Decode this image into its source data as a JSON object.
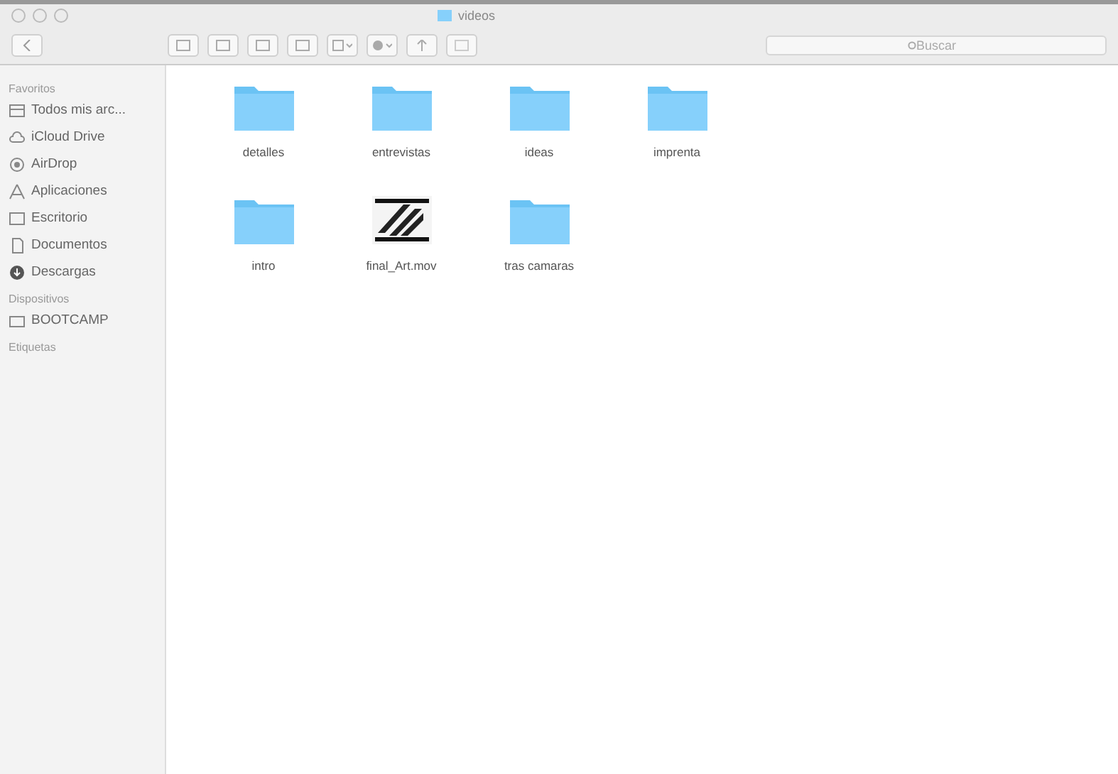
{
  "window": {
    "title": "videos"
  },
  "search": {
    "placeholder": "Buscar"
  },
  "sidebar": {
    "sections": [
      {
        "heading": "Favoritos",
        "items": [
          {
            "label": "Todos mis arc...",
            "kind": "files"
          },
          {
            "label": "iCloud Drive",
            "kind": "cloud"
          },
          {
            "label": "AirDrop",
            "kind": "airdrop"
          },
          {
            "label": "Aplicaciones",
            "kind": "apps"
          },
          {
            "label": "Escritorio",
            "kind": "desktop"
          },
          {
            "label": "Documentos",
            "kind": "docs"
          },
          {
            "label": "Descargas",
            "kind": "download"
          }
        ]
      },
      {
        "heading": "Dispositivos",
        "items": [
          {
            "label": "BOOTCAMP",
            "kind": "disk"
          }
        ]
      },
      {
        "heading": "Etiquetas"
      }
    ]
  },
  "files": [
    {
      "name": "detalles",
      "kind": "folder"
    },
    {
      "name": "entrevistas",
      "kind": "folder"
    },
    {
      "name": "ideas",
      "kind": "folder"
    },
    {
      "name": "imprenta",
      "kind": "folder"
    },
    {
      "name": "intro",
      "kind": "folder"
    },
    {
      "name": "final_Art.mov",
      "kind": "movie"
    },
    {
      "name": "tras camaras",
      "kind": "folder"
    }
  ]
}
